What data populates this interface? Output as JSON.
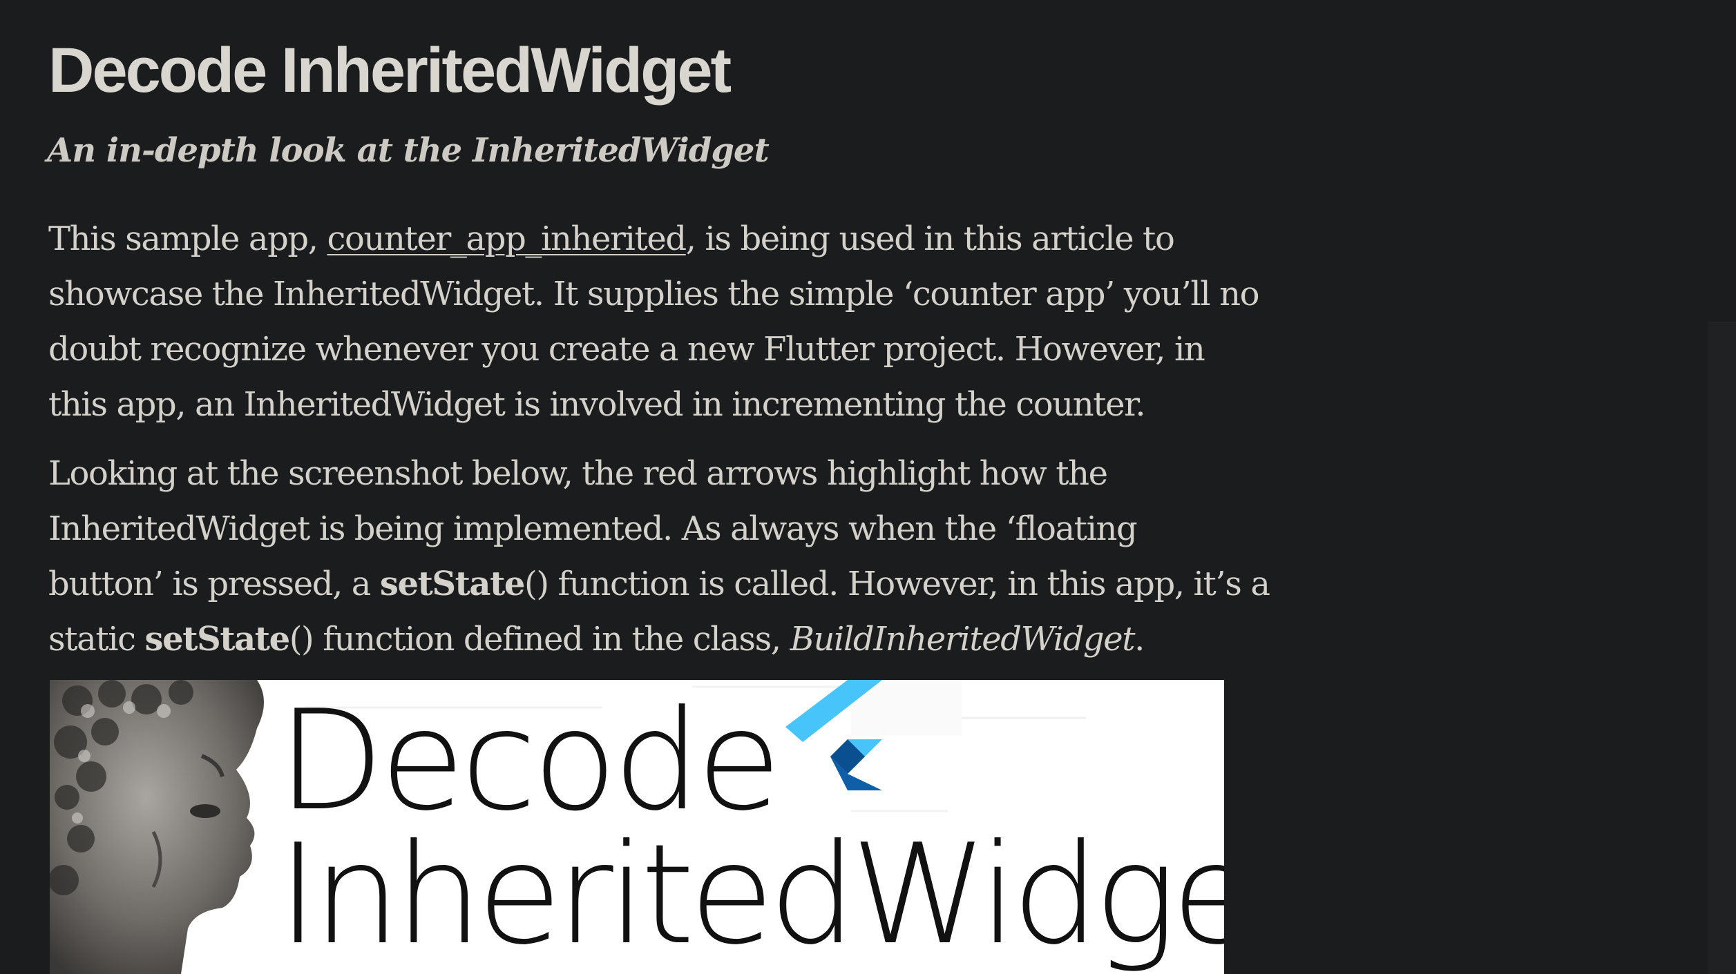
{
  "article": {
    "title": "Decode InheritedWidget",
    "subtitle": "An in-depth look at the InheritedWidget",
    "paragraph1": {
      "before_link": "This sample app, ",
      "link_text": "counter_app_inherited",
      "after_link": ", is being used in this article to",
      "line2": "showcase the InheritedWidget. It supplies the simple ‘counter app’ you’ll no",
      "line3": "doubt recognize whenever you create a new Flutter project. However, in",
      "line4": "this app, an InheritedWidget is involved in incrementing the counter."
    },
    "paragraph2": {
      "line1": "Looking at the screenshot below, the red arrows highlight how the",
      "line2": "InheritedWidget is being implemented. As always when the ‘floating",
      "line3_a": "button’ is pressed, a ",
      "line3_bold": "setState",
      "line3_b": "() function is called. However, in this app, it’s a",
      "line4_a": "static ",
      "line4_bold": "setState",
      "line4_b": "() function defined in the class, ",
      "line4_italic": "BuildInheritedWidget",
      "line4_end": "."
    }
  },
  "hero_image": {
    "word1": "Decode",
    "word2": "InheritedWidget",
    "bust_icon": "david-bust-icon",
    "logo_icon": "flutter-logo-icon",
    "colors": {
      "flutter_light": "#47c5fb",
      "flutter_dark": "#0f5ea8",
      "text": "#111111",
      "background": "#ffffff"
    }
  },
  "colors": {
    "page_background": "#1b1c1e",
    "text": "#d4d1cb",
    "title": "#d9d5cf"
  }
}
